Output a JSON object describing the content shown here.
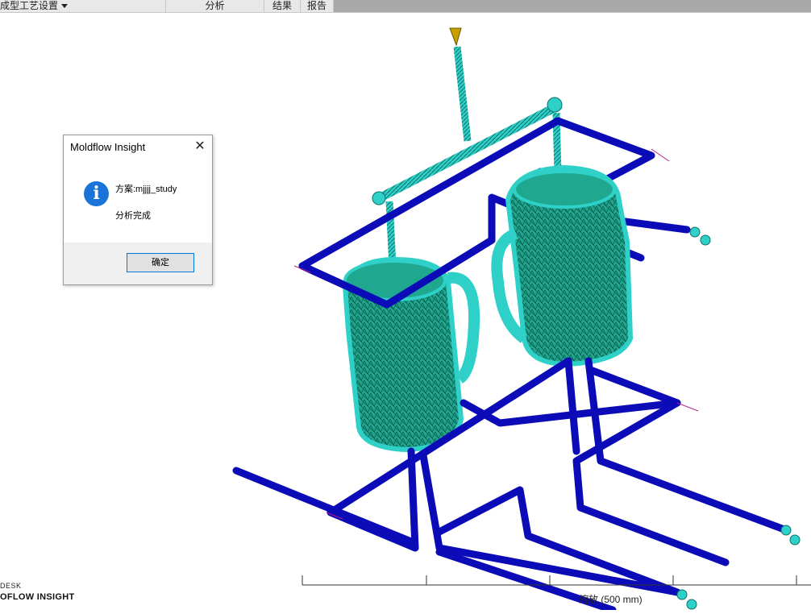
{
  "toolbar": {
    "tabs": [
      {
        "label": "成型工艺设置"
      },
      {
        "label": "分析"
      },
      {
        "label": "结果"
      },
      {
        "label": "报告"
      }
    ]
  },
  "dialog": {
    "title": "Moldflow Insight",
    "message_study": "方案:mjjjj_study",
    "message_status": "分析完成",
    "ok_label": "确定",
    "icon": "info-icon"
  },
  "brand": {
    "line1": "DESK",
    "line2": "OFLOW INSIGHT"
  },
  "scale": {
    "label": "缩放 (500 mm)"
  },
  "colors": {
    "mesh": "#2fd0c8",
    "part": "#1fa88f",
    "cooling": "#0b0bb8",
    "nozzle": "#c8a000"
  }
}
